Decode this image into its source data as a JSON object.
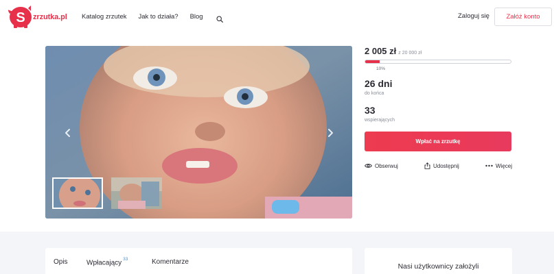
{
  "header": {
    "logo_text": "zrzutka.pl",
    "nav": [
      "Katalog zrzutek",
      "Jak to działa?",
      "Blog"
    ],
    "search_icon": "search-icon",
    "login_label": "Zaloguj się",
    "signup_label": "Załóż konto"
  },
  "gallery": {
    "thumbnail_count": 2,
    "active_thumbnail": 1,
    "prev_icon": "chevron-left-icon",
    "next_icon": "chevron-right-icon"
  },
  "stats": {
    "amount": "2 005 zł",
    "goal": "z 20 000 zł",
    "progress_fraction": 0.1,
    "percent_label": "10%",
    "days_value": "26 dni",
    "days_label": "do końca",
    "supporters_value": "33",
    "supporters_label": "wspierających"
  },
  "actions": {
    "pay_label": "Wpłać na zrzutkę",
    "follow_label": "Obserwuj",
    "share_label": "Udostępnij",
    "more_label": "Więcej"
  },
  "tabs": {
    "description": "Opis",
    "donors": "Wpłacający",
    "donors_count": "33",
    "comments": "Komentarze"
  },
  "side": {
    "title": "Nasi użytkownicy założyli"
  },
  "colors": {
    "accent": "#e7304a",
    "badge_blue": "#3d8fe0"
  }
}
